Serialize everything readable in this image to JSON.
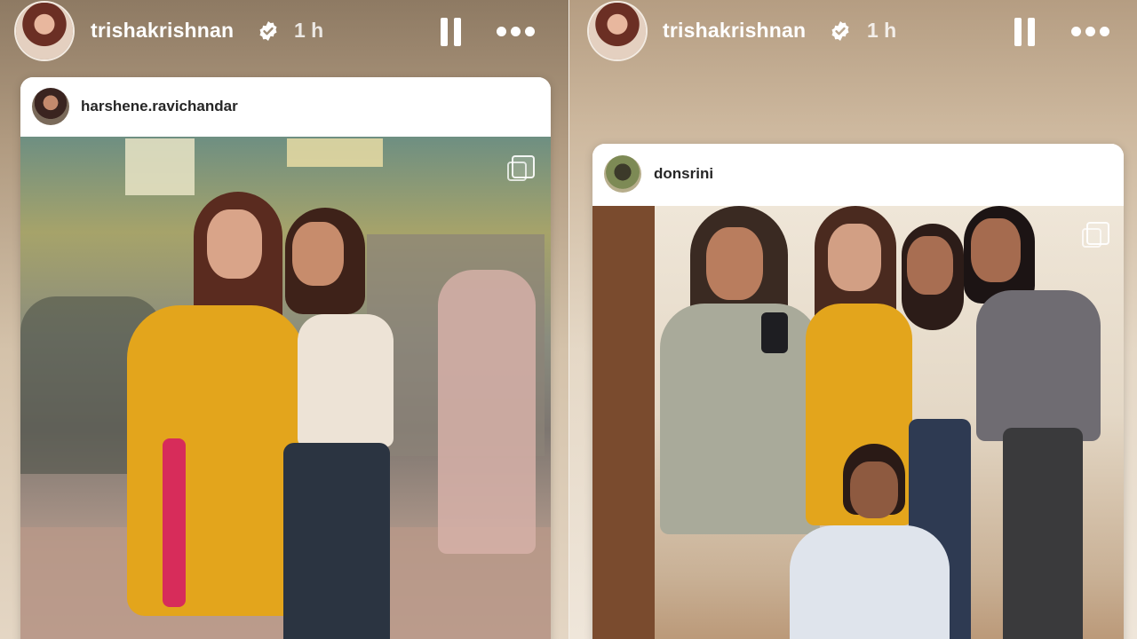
{
  "stories": [
    {
      "owner_username": "trishakrishnan",
      "timestamp": "1 h",
      "verified": true,
      "post": {
        "author_username": "harshene.ravichandar"
      }
    },
    {
      "owner_username": "trishakrishnan",
      "timestamp": "1 h",
      "verified": true,
      "post": {
        "author_username": "donsrini"
      }
    }
  ],
  "colors": {
    "verified_badge": "#ffffff",
    "saree_yellow": "#e3a51c",
    "accent_pink": "#d72c5a",
    "card_bg": "#ffffff",
    "username_text": "#262626"
  },
  "icons": [
    "verified-icon",
    "pause-icon",
    "more-options-icon",
    "multiple-photos-icon"
  ]
}
